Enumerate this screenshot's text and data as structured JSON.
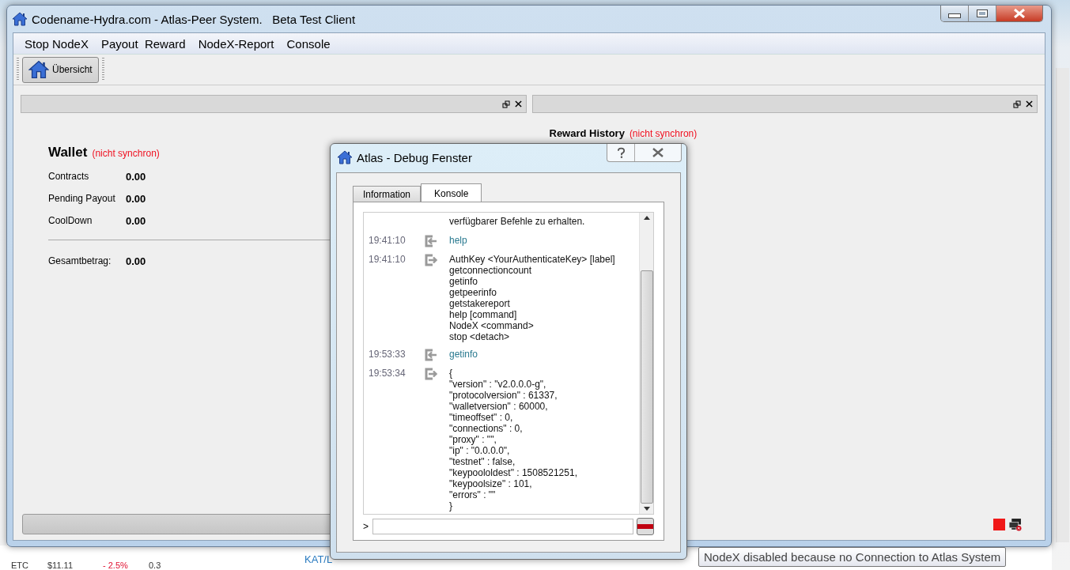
{
  "background_window": {
    "rows": [
      {
        "cells": [
          "ETC",
          "$11.11",
          "- 2.5%",
          "0.3"
        ]
      }
    ],
    "link": "KAT/L"
  },
  "window": {
    "title": "Codename-Hydra.com - Atlas-Peer System.   Beta Test Client"
  },
  "menu": [
    "Stop NodeX",
    "Payout  Reward",
    "NodeX-Report",
    "Console"
  ],
  "toolbar": [
    {
      "label": "Übersicht",
      "selected": true
    }
  ],
  "wallet": {
    "title": "Wallet",
    "status": "(nicht synchron)",
    "rows": [
      {
        "label": "Contracts",
        "value": "0.00"
      },
      {
        "label": "Pending Payout",
        "value": "0.00"
      },
      {
        "label": "CoolDown",
        "value": "0.00"
      }
    ],
    "total": {
      "label": "Gesamtbetrag:",
      "value": "0.00"
    }
  },
  "reward_history": {
    "title": "Reward History",
    "status": "(nicht synchron)"
  },
  "status": {
    "connected": false
  },
  "progress": {
    "level": 0
  },
  "dialog": {
    "title": "Atlas - Debug Fenster",
    "tabs": [
      {
        "label": "Information",
        "selected": false
      },
      {
        "label": "Konsole",
        "selected": true
      }
    ],
    "entries": [
      {
        "kind": "info",
        "lines": [
          "verfügbarer Befehle zu erhalten."
        ]
      },
      {
        "time": "19:41:10",
        "kind": "request",
        "lines": [
          "help"
        ]
      },
      {
        "time": "19:41:10",
        "kind": "reply",
        "lines": [
          "AuthKey <YourAuthenticateKey> [label]",
          "getconnectioncount",
          "getinfo",
          "getpeerinfo",
          "getstakereport",
          "help [command]",
          "NodeX <command>",
          "stop <detach>"
        ]
      },
      {
        "time": "19:53:33",
        "kind": "request",
        "lines": [
          "getinfo"
        ]
      },
      {
        "time": "19:53:34",
        "kind": "reply",
        "lines": [
          "{",
          "\"version\" : \"v2.0.0.0-g\",",
          "\"protocolversion\" : 61337,",
          "\"walletversion\" : 60000,",
          "\"timeoffset\" : 0,",
          "\"connections\" : 0,",
          "\"proxy\" : \"\",",
          "\"ip\" : \"0.0.0.0\",",
          "\"testnet\" : false,",
          "\"keypoololdest\" : 1508521251,",
          "\"keypoolsize\" : 101,",
          "\"errors\" : \"\"",
          "}"
        ]
      }
    ],
    "prompt": ">"
  },
  "tooltip": "NodeX disabled because no Connection to Atlas System"
}
